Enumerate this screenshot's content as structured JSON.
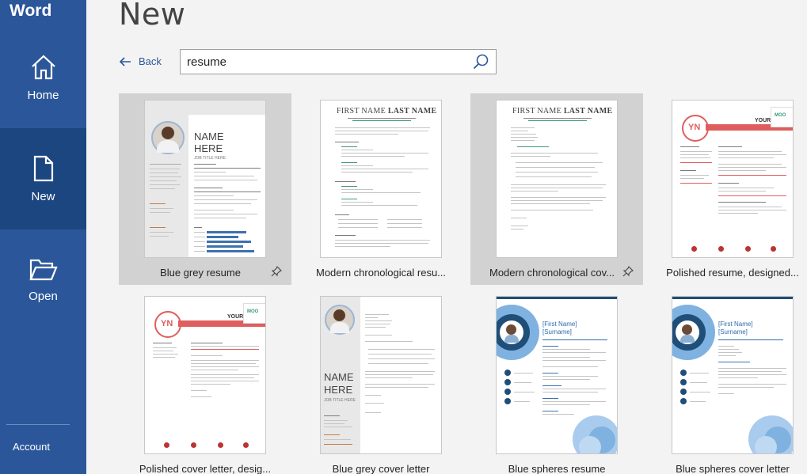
{
  "app": {
    "name": "Word"
  },
  "sidebar": {
    "items": [
      {
        "label": "Home",
        "icon": "home-icon"
      },
      {
        "label": "New",
        "icon": "new-document-icon"
      },
      {
        "label": "Open",
        "icon": "folder-open-icon"
      }
    ],
    "account_label": "Account"
  },
  "page": {
    "title": "New",
    "back_label": "Back"
  },
  "search": {
    "value": "resume",
    "icon": "search-icon"
  },
  "templates": [
    {
      "label": "Blue grey resume",
      "selected": true,
      "pin": true,
      "thumb": {
        "name": "NAME",
        "name2": "HERE",
        "subtitle": "JOB TITLE HERE"
      }
    },
    {
      "label": "Modern chronological resu...",
      "selected": false,
      "pin": false,
      "thumb": {
        "first": "FIRST NAME",
        "last": "LAST NAME"
      }
    },
    {
      "label": "Modern chronological cov...",
      "selected": true,
      "pin": true,
      "thumb": {
        "first": "FIRST NAME",
        "last": "LAST NAME"
      }
    },
    {
      "label": "Polished resume, designed...",
      "selected": false,
      "pin": false,
      "thumb": {
        "initials": "YN",
        "header": "YOUR N",
        "brand": "MOO"
      }
    },
    {
      "label": "Polished cover letter, desig...",
      "selected": false,
      "pin": false,
      "thumb": {
        "initials": "YN",
        "header": "YOUR N",
        "brand": "MOO"
      }
    },
    {
      "label": "Blue grey cover letter",
      "selected": false,
      "pin": false,
      "thumb": {
        "name": "NAME",
        "name2": "HERE",
        "subtitle": "JOB TITLE HERE"
      }
    },
    {
      "label": "Blue spheres resume",
      "selected": false,
      "pin": false,
      "thumb": {
        "first": "[First Name]",
        "last": "[Surname]"
      }
    },
    {
      "label": "Blue spheres cover letter",
      "selected": false,
      "pin": false,
      "thumb": {
        "first": "[First Name]",
        "last": "[Surname]"
      }
    }
  ],
  "colors": {
    "sidebar": "#2b579a",
    "sidebar_active": "#1b4680",
    "accent": "#2b579a",
    "selected_tile": "#d2d2d2"
  }
}
